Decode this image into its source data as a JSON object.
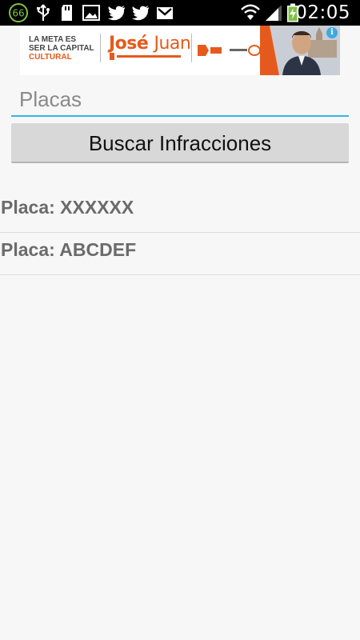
{
  "status_bar": {
    "notification_count": "66",
    "time": "02:05",
    "icons": [
      "badge-66-icon",
      "usb-icon",
      "sd-card-icon",
      "image-icon",
      "twitter-icon",
      "twitter-icon",
      "gmail-icon",
      "wifi-icon",
      "signal-icon",
      "battery-charging-icon"
    ]
  },
  "ad_banner": {
    "slogan_line1": "LA META ES",
    "slogan_line2": "SER LA CAPITAL",
    "slogan_line3": "CULTURAL",
    "name_bold": "José",
    "name_thin": "Juan",
    "info_icon": "i",
    "accent_color": "#e55a1c"
  },
  "search": {
    "placeholder": "Placas",
    "value": ""
  },
  "search_button": {
    "label": "Buscar Infracciones"
  },
  "plates": [
    {
      "label": "Placa: XXXXXX"
    },
    {
      "label": "Placa: ABCDEF"
    }
  ],
  "colors": {
    "input_underline": "#33b5e5",
    "background": "#f7f7f7",
    "status_bar": "#000000"
  }
}
